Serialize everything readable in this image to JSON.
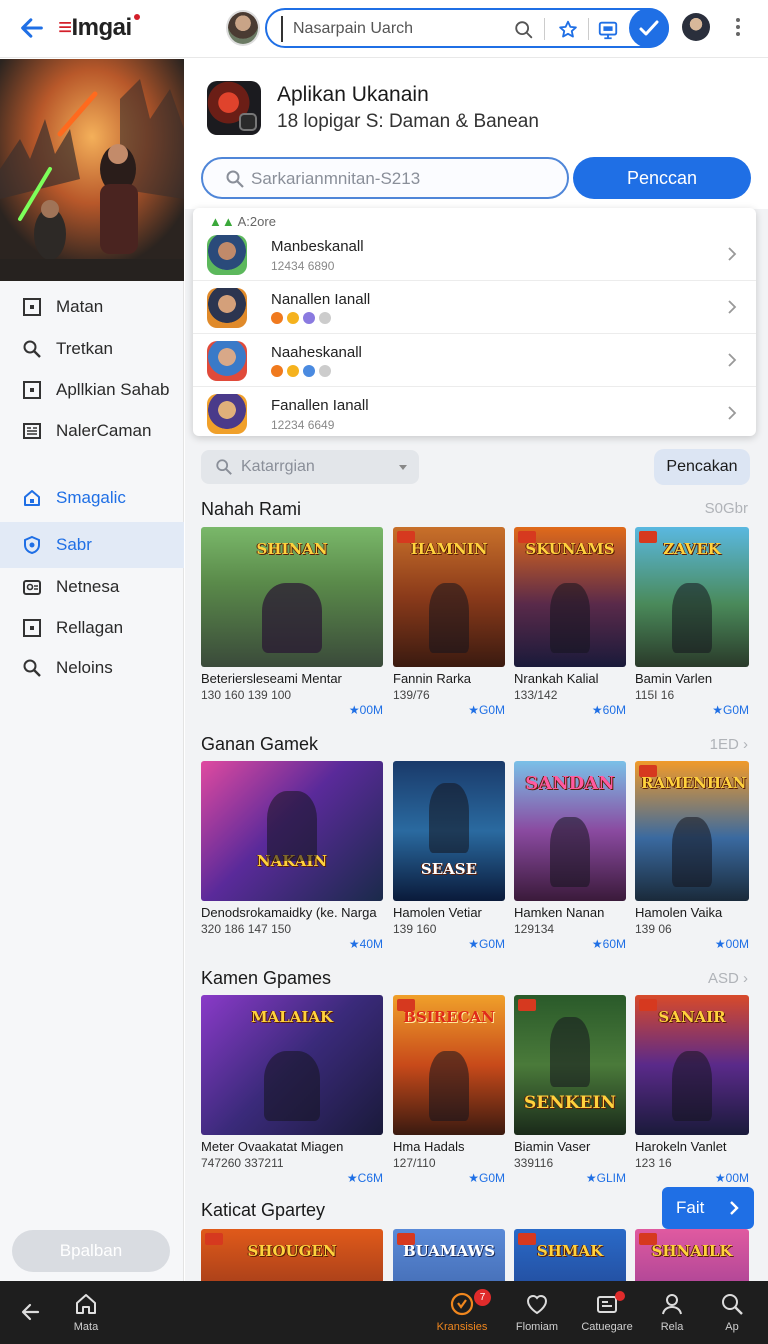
{
  "header": {
    "logo_text": "Imgai",
    "search_placeholder": "Nasarpain Uarch"
  },
  "sidebar": {
    "items": [
      {
        "label": "Matan",
        "icon": "square-icon"
      },
      {
        "label": "Tretkan",
        "icon": "search-icon"
      },
      {
        "label": "Apllkian Sahab",
        "icon": "square-icon"
      },
      {
        "label": "NalerCaman",
        "icon": "list-icon"
      },
      {
        "label": "Smagalic",
        "icon": "home-icon"
      },
      {
        "label": "Sabr",
        "icon": "shield-icon"
      },
      {
        "label": "Netnesa",
        "icon": "people-icon"
      },
      {
        "label": "Rellagan",
        "icon": "square-icon"
      },
      {
        "label": "Neloins",
        "icon": "search-icon"
      }
    ],
    "active_index": 5,
    "bottom_button": "Bpalban"
  },
  "app": {
    "title": "Aplikan Ukanain",
    "subtitle": "18 lopigar S: Daman & Banean",
    "search_placeholder": "Sarkarianmnitan-S213",
    "primary_button": "Penccan"
  },
  "suggestions": {
    "header": "A:2ore",
    "rows": [
      {
        "name": "Manbeskanall",
        "meta": "12434 6890"
      },
      {
        "name": "Nanallen Ianall",
        "meta": ""
      },
      {
        "name": "Naaheskanall",
        "meta": ""
      },
      {
        "name": "Fanallen Ianall",
        "meta": "12234 6649"
      }
    ]
  },
  "filter": {
    "category_placeholder": "Katarrgian",
    "button": "Pencakan"
  },
  "sections": [
    {
      "title": "Nahah Rami",
      "more": "S0Gbr",
      "cards": [
        {
          "thumb_title": "SHINAN",
          "name": "Beteriersleseami Mentar",
          "meta": "130 160  139 100",
          "rating": "★00M"
        },
        {
          "thumb_title": "HAMNIN",
          "name": "Fannin Rarka",
          "meta": "139/76",
          "rating": "★G0M"
        },
        {
          "thumb_title": "SKUNAMS",
          "name": "Nrankah Kalial",
          "meta": "133/142",
          "rating": "★60M"
        },
        {
          "thumb_title": "ZAVEK",
          "name": "Bamin Varlen",
          "meta": "115I 16",
          "rating": "★G0M"
        }
      ]
    },
    {
      "title": "Ganan Gamek",
      "more": "1ED",
      "cards": [
        {
          "thumb_title": "NAKAIN",
          "name": "Denodsrokamaidky (ke. Narga",
          "meta": "320 186  147 150",
          "rating": "★40M"
        },
        {
          "thumb_title": "SEASE",
          "name": "Hamolen Vetiar",
          "meta": "139 160",
          "rating": "★G0M"
        },
        {
          "thumb_title": "SANDAN",
          "name": "Hamken Nanan",
          "meta": "129134",
          "rating": "★60M"
        },
        {
          "thumb_title": "RAMENHAN",
          "name": "Hamolen Vaika",
          "meta": "139 06",
          "rating": "★00M"
        }
      ]
    },
    {
      "title": "Kamen Gpames",
      "more": "ASD",
      "cards": [
        {
          "thumb_title": "MALAIAK",
          "name": "Meter Ovaakatat Miagen",
          "meta": "747260  337211",
          "rating": "★C6M"
        },
        {
          "thumb_title": "BSIRECAN",
          "name": "Hma Hadals",
          "meta": "127/110",
          "rating": "★G0M"
        },
        {
          "thumb_title": "SENKEIN",
          "name": "Biamin Vaser",
          "meta": "339116",
          "rating": "★GLIM"
        },
        {
          "thumb_title": "SANAIR",
          "name": "Harokeln Vanlet",
          "meta": "123 16",
          "rating": "★00M"
        }
      ]
    },
    {
      "title": "Katicat Gpartey",
      "more": "",
      "cards": [
        {
          "thumb_title": "SHOUGEN",
          "name": "",
          "meta": "",
          "rating": ""
        },
        {
          "thumb_title": "BUAMAWS",
          "name": "",
          "meta": "",
          "rating": ""
        },
        {
          "thumb_title": "SHMAK",
          "name": "",
          "meta": "",
          "rating": ""
        },
        {
          "thumb_title": "SHNAILK",
          "name": "",
          "meta": "",
          "rating": ""
        }
      ]
    }
  ],
  "float_button": "Fait",
  "bottom_nav": [
    {
      "label": "Mata",
      "icon": "home-icon",
      "badge": ""
    },
    {
      "label": "Kransisies",
      "icon": "game-icon",
      "badge": "7"
    },
    {
      "label": "Flomiam",
      "icon": "heart-icon",
      "badge": ""
    },
    {
      "label": "Catuegare",
      "icon": "category-icon",
      "badge": ""
    },
    {
      "label": "Rela",
      "icon": "profile-icon",
      "badge": ""
    },
    {
      "label": "Ap",
      "icon": "search-icon",
      "badge": ""
    }
  ],
  "colors": {
    "accent": "#1f6fe5",
    "brand_red": "#d31f2a",
    "active_tab": "#f0871e"
  }
}
